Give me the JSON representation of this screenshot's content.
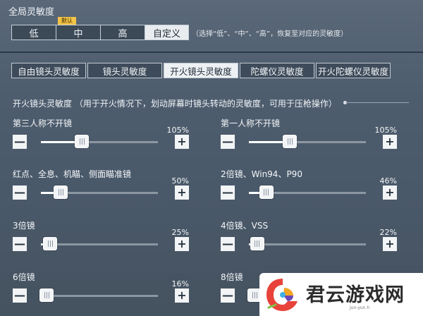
{
  "global": {
    "title": "全局灵敏度",
    "default_tag": "默认",
    "presets": [
      {
        "label": "低",
        "selected": false
      },
      {
        "label": "中",
        "selected": false
      },
      {
        "label": "高",
        "selected": false
      },
      {
        "label": "自定义",
        "selected": true
      }
    ],
    "hint": "（选择“低”、“中”、“高”，恢复至对应的灵敏度）"
  },
  "tabs": [
    {
      "label": "自由镜头灵敏度",
      "selected": false
    },
    {
      "label": "镜头灵敏度",
      "selected": false
    },
    {
      "label": "开火镜头灵敏度",
      "selected": true
    },
    {
      "label": "陀螺仪灵敏度",
      "selected": false
    },
    {
      "label": "开火陀螺仪灵敏度",
      "selected": false
    }
  ],
  "section": {
    "title": "开火镜头灵敏度 （用于开火情况下，划动屏幕时镜头转动的灵敏度，可用于压枪操作）"
  },
  "sliders": [
    {
      "label": "第三人称不开镜",
      "value_text": "105%",
      "level": 0.35
    },
    {
      "label": "第一人称不开镜",
      "value_text": "105%",
      "level": 0.35
    },
    {
      "label": "红点、全息、机瞄、侧面瞄准镜",
      "value_text": "50%",
      "level": 0.17
    },
    {
      "label": "2倍镜、Win94、P90",
      "value_text": "46%",
      "level": 0.15
    },
    {
      "label": "3倍镜",
      "value_text": "25%",
      "level": 0.08
    },
    {
      "label": "4倍镜、VSS",
      "value_text": "22%",
      "level": 0.07
    },
    {
      "label": "6倍镜",
      "value_text": "16%",
      "level": 0.05
    },
    {
      "label": "8倍镜",
      "value_text": "",
      "level": 0.05
    }
  ],
  "buttons": {
    "minus": "—",
    "plus": "+"
  },
  "watermark": {
    "text": "君云游戏网",
    "sub": "jun-yun.h"
  }
}
